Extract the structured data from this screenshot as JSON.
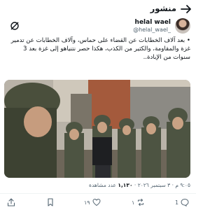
{
  "header": {
    "title": "منشور",
    "back_icon": "arrow-right-icon"
  },
  "author": {
    "name": "helal wael",
    "handle": "@helal_wael_",
    "avatar_icon": "avatar-photo",
    "grok_icon": "grok-icon"
  },
  "tweet": {
    "text": "• بعد آلاف الخطابات عن القضاء على حماس، وآلاف الخطابات عن تدمير غزة والمقاومة، والكثير من الكذب، هكذا حصر نتنياهو إلى غزة بعد 3 سنوات من الإبادة..",
    "timestamp": "٩:٠٥ م · ٣ سبتمبر ٢٠٢٦",
    "views_count": "١,١٣٠",
    "views_label": "عدد مشاهدة"
  },
  "actions": {
    "reply_count": "1",
    "retweet_count": "١",
    "like_count": "١٩",
    "icons": [
      "reply-icon",
      "retweet-icon",
      "like-icon",
      "bookmark-icon",
      "share-icon"
    ]
  },
  "colors": {
    "text": "#0f1419",
    "muted": "#536471",
    "divider": "#eff3f4"
  }
}
